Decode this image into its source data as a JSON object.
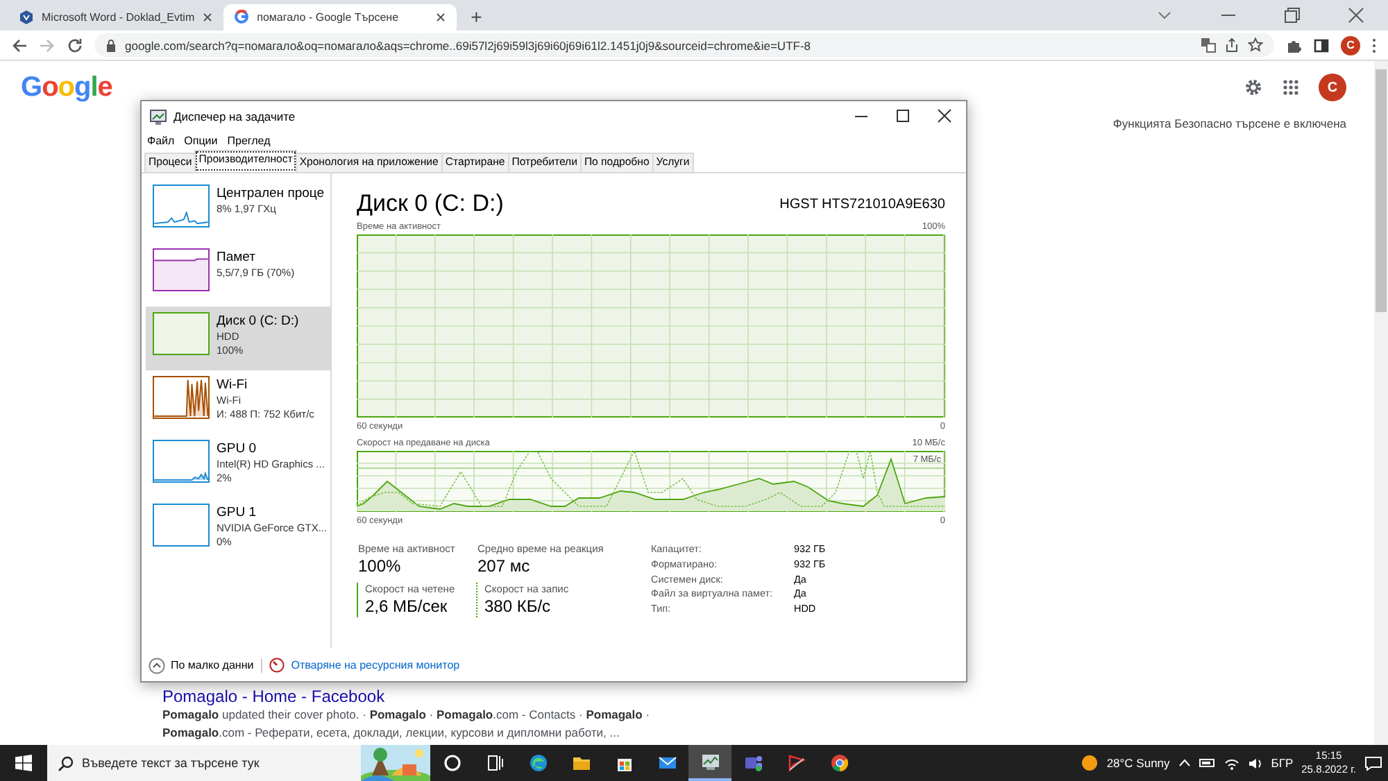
{
  "browser": {
    "tabs": [
      {
        "kind": "word",
        "title": "Microsoft Word - Doklad_Evtim",
        "selected": false
      },
      {
        "kind": "google",
        "title": "помагало - Google Търсене",
        "selected": true
      }
    ],
    "new_tab": "+",
    "address": "google.com/search?q=помагало&oq=помагало&aqs=chrome..69i57l2j69i59l3j69i60j69i61l2.1451j0j9&sourceid=chrome&ie=UTF-8",
    "profile": "C"
  },
  "google": {
    "logo": "Google",
    "avatar": "C",
    "safe_search": "Функцията Безопасно търсене е включена",
    "result": {
      "title": "Pomagalo - Home - Facebook",
      "lines": [
        "**Pomagalo** updated their cover photo. · **Pomagalo** · **Pomagalo**.com - Contacts · **Pomagalo** ·",
        "**Pomagalo**.com - Реферати, есета, доклади, лекции, курсови и дипломни работи, ..."
      ]
    }
  },
  "task_manager": {
    "title": "Диспечер на задачите",
    "menu": [
      "Файл",
      "Опции",
      "Преглед"
    ],
    "tabs": [
      {
        "label": "Процеси",
        "selected": false
      },
      {
        "label": "Производителност",
        "selected": true
      },
      {
        "label": "Хронология на приложение",
        "selected": false
      },
      {
        "label": "Стартиране",
        "selected": false
      },
      {
        "label": "Потребители",
        "selected": false
      },
      {
        "label": "По подробно",
        "selected": false
      },
      {
        "label": "Услуги",
        "selected": false
      }
    ],
    "resources": [
      {
        "kind": "cpu",
        "name": "Централен проце",
        "details": [
          "8% 1,97 ГХц"
        ],
        "color": "#1a8ad4",
        "selected": false
      },
      {
        "kind": "memory",
        "name": "Памет",
        "details": [
          "5,5/7,9 ГБ (70%)"
        ],
        "color": "#9b30b0",
        "selected": false
      },
      {
        "kind": "disk",
        "name": "Диск 0 (C: D:)",
        "details": [
          "HDD",
          "100%"
        ],
        "color": "#4da60c",
        "selected": true
      },
      {
        "kind": "wifi",
        "name": "Wi-Fi",
        "details": [
          "Wi-Fi",
          "И: 488 П: 752 Кбит/с"
        ],
        "color": "#a74f01",
        "selected": false
      },
      {
        "kind": "gpu",
        "name": "GPU 0",
        "details": [
          "Intel(R) HD Graphics ...",
          "2%"
        ],
        "color": "#1a8ad4",
        "selected": false
      },
      {
        "kind": "gpu_idle",
        "name": "GPU 1",
        "details": [
          "NVIDIA GeForce GTX...",
          "0%"
        ],
        "color": "#1a8ad4",
        "selected": false
      }
    ],
    "disk": {
      "title": "Диск 0 (C: D:)",
      "model": "HGST HTS721010A9E630",
      "activity_graph": {
        "label": "Време на активност",
        "max": "100%",
        "time": "60 секунди",
        "min": "0"
      },
      "transfer_graph": {
        "label": "Скорост на предаване на диска",
        "max": "10 МБ/с",
        "mid": "7 МБ/с",
        "time": "60 секунди",
        "min": "0"
      },
      "stats": [
        {
          "kind": "plain",
          "label": "Време на активност",
          "value": "100%"
        },
        {
          "kind": "plain",
          "label": "Средно време на реакция",
          "value": "207 мс"
        },
        {
          "kind": "read",
          "label": "Скорост на четене",
          "value": "2,6 МБ/сек"
        },
        {
          "kind": "write",
          "label": "Скорост на запис",
          "value": "380 КБ/с"
        }
      ],
      "properties": [
        {
          "label": "Капацитет:",
          "value": "932 ГБ"
        },
        {
          "label": "Форматирано:",
          "value": "932 ГБ"
        },
        {
          "label": "Системен диск:",
          "value": "Да"
        },
        {
          "label": "Файл за виртуална памет:",
          "value": "Да"
        },
        {
          "label": "Тип:",
          "value": "HDD"
        }
      ]
    },
    "footer": {
      "fewer": "По малко данни",
      "monitor": "Отваряне на ресурсния монитор"
    }
  },
  "taskbar": {
    "search": "Въведете текст за търсене тук",
    "apps": [
      {
        "kind": "cortana",
        "selected": false
      },
      {
        "kind": "taskview",
        "selected": false
      },
      {
        "kind": "edge",
        "selected": false
      },
      {
        "kind": "explorer",
        "selected": false
      },
      {
        "kind": "store",
        "selected": false
      },
      {
        "kind": "mail",
        "selected": false
      },
      {
        "kind": "taskmgr",
        "selected": true
      },
      {
        "kind": "teams",
        "selected": false
      },
      {
        "kind": "app",
        "selected": false
      },
      {
        "kind": "chrome",
        "selected": false
      }
    ],
    "weather": "28°C  Sunny",
    "language": "БГР",
    "time": "15:15",
    "date": "25.8.2022 г."
  }
}
